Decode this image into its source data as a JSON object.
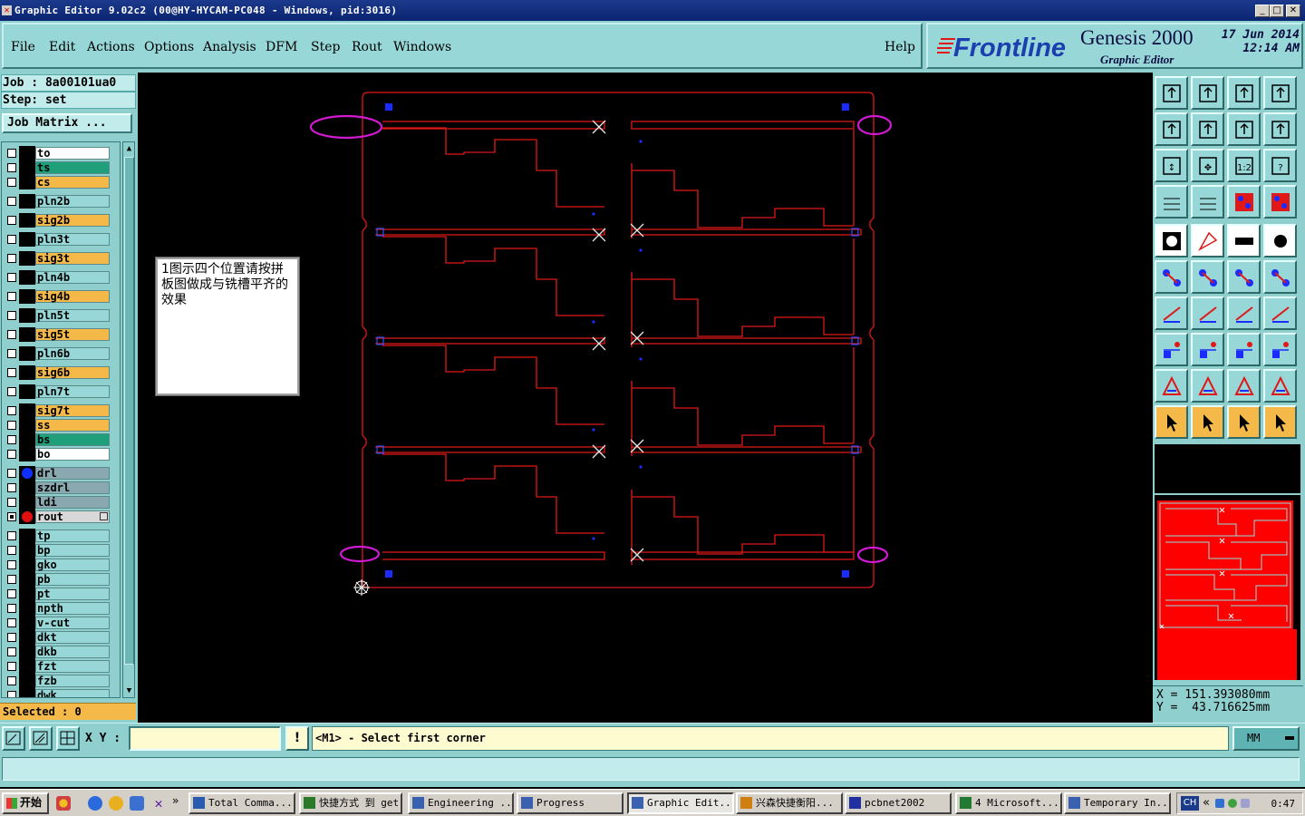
{
  "window": {
    "title": "Graphic Editor 9.02c2 (00@HY-HYCAM-PC048 - Windows, pid:3016)"
  },
  "menu": {
    "items": [
      "File",
      "Edit",
      "Actions",
      "Options",
      "Analysis",
      "DFM",
      "Step",
      "Rout",
      "Windows"
    ],
    "help": "Help"
  },
  "brand": {
    "logo": "Frontline",
    "product": "Genesis 2000",
    "module": "Graphic Editor",
    "date": "17 Jun 2014",
    "time": "12:14 AM"
  },
  "job": {
    "job_label": "Job : 8a00101ua0",
    "step_label": "Step: set",
    "matrix_button": "Job Matrix ..."
  },
  "layers": [
    {
      "name": "to",
      "color": "#ffffff"
    },
    {
      "name": "ts",
      "color": "#1fa07a"
    },
    {
      "name": "cs",
      "color": "#f5b94a"
    },
    {
      "name": "pln2b",
      "color": "#97d7d7"
    },
    {
      "name": "sig2b",
      "color": "#f5b94a"
    },
    {
      "name": "pln3t",
      "color": "#97d7d7"
    },
    {
      "name": "sig3t",
      "color": "#f5b94a"
    },
    {
      "name": "pln4b",
      "color": "#97d7d7"
    },
    {
      "name": "sig4b",
      "color": "#f5b94a"
    },
    {
      "name": "pln5t",
      "color": "#97d7d7"
    },
    {
      "name": "sig5t",
      "color": "#f5b94a"
    },
    {
      "name": "pln6b",
      "color": "#97d7d7"
    },
    {
      "name": "sig6b",
      "color": "#f5b94a"
    },
    {
      "name": "pln7t",
      "color": "#97d7d7"
    },
    {
      "name": "sig7t",
      "color": "#f5b94a"
    },
    {
      "name": "ss",
      "color": "#f5b94a"
    },
    {
      "name": "bs",
      "color": "#1fa07a"
    },
    {
      "name": "bo",
      "color": "#ffffff"
    },
    {
      "name": "drl",
      "color": "#8aa8b0",
      "dot": "#1030ff"
    },
    {
      "name": "szdrl",
      "color": "#8aa8b0"
    },
    {
      "name": "ldi",
      "color": "#8aa8b0"
    },
    {
      "name": "rout",
      "color": "#d8d8d8",
      "dot": "#e01010",
      "active": true
    },
    {
      "name": "tp",
      "color": "#97d7d7"
    },
    {
      "name": "bp",
      "color": "#97d7d7"
    },
    {
      "name": "gko",
      "color": "#97d7d7"
    },
    {
      "name": "pb",
      "color": "#97d7d7"
    },
    {
      "name": "pt",
      "color": "#97d7d7"
    },
    {
      "name": "npth",
      "color": "#97d7d7"
    },
    {
      "name": "v-cut",
      "color": "#97d7d7"
    },
    {
      "name": "dkt",
      "color": "#97d7d7"
    },
    {
      "name": "dkb",
      "color": "#97d7d7"
    },
    {
      "name": "fzt",
      "color": "#97d7d7"
    },
    {
      "name": "fzb",
      "color": "#97d7d7"
    },
    {
      "name": "dwk",
      "color": "#97d7d7"
    }
  ],
  "selected_label": "Selected : 0",
  "note": "1图示四个位置请按拼板图做成与铣槽平齐的效果",
  "coords": {
    "x": "X = 151.393080mm",
    "y": "Y =  43.716625mm"
  },
  "command": {
    "xy_label": "X Y :",
    "xy_value": "",
    "prompt": "<M1> - Select first corner",
    "units": "MM"
  },
  "taskbar": {
    "start": "开始",
    "tasks": [
      "Total Comma...",
      "快捷方式 到 get",
      "Engineering ...",
      "Progress",
      "Graphic Edit...",
      "兴森快捷衡阳...",
      "pcbnet2002",
      "4 Microsoft...",
      "Temporary In..."
    ],
    "lang": "CH",
    "clock": "0:47"
  },
  "colors": {
    "ui_teal": "#8fd0cf",
    "profile": "#e01818",
    "highlight": "#d21ad2",
    "pads": "#1a2cff"
  }
}
